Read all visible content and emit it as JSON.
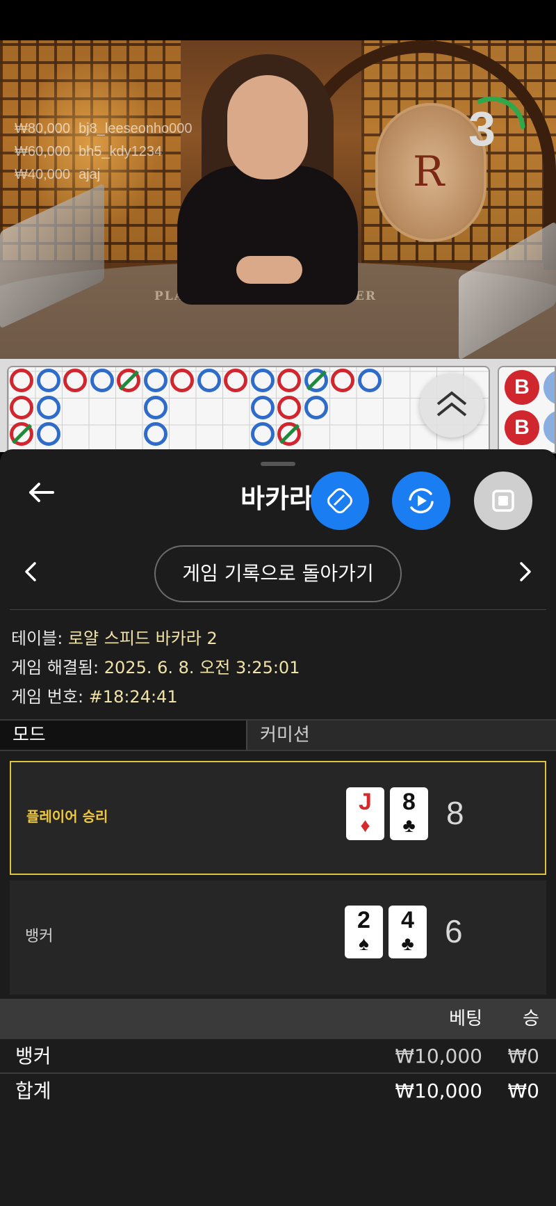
{
  "video": {
    "felt_labels": [
      "PLAYER",
      "BANKER"
    ],
    "emblem_letter": "R",
    "countdown": "3",
    "bets": [
      {
        "amount": "₩80,000",
        "user": "bj8_leeseonho000"
      },
      {
        "amount": "₩60,000",
        "user": "bh5_kdy1234"
      },
      {
        "amount": "₩40,000",
        "user": "ajaj"
      }
    ]
  },
  "roads": {
    "bead_labels": [
      "B",
      "B"
    ]
  },
  "sheet": {
    "title": "바카라",
    "back_to_history": "게임 기록으로 돌아가기",
    "info": {
      "table_label": "테이블:",
      "table_value": "로얄 스피드 바카라 2",
      "resolved_label": "게임 해결됨:",
      "resolved_value": "2025. 6. 8. 오전 3:25:01",
      "game_no_label": "게임 번호:",
      "game_no_value": "#18:24:41"
    },
    "tabs": {
      "mode": "모드",
      "commission": "커미션"
    },
    "results": {
      "player": {
        "label": "플레이어 승리",
        "cards": [
          {
            "rank": "J",
            "suit": "♦"
          },
          {
            "rank": "8",
            "suit": "♣"
          }
        ],
        "score": "8"
      },
      "banker": {
        "label": "뱅커",
        "cards": [
          {
            "rank": "2",
            "suit": "♠"
          },
          {
            "rank": "4",
            "suit": "♣"
          }
        ],
        "score": "6"
      }
    },
    "bet_table": {
      "headers": {
        "bet": "베팅",
        "win": "승"
      },
      "rows": [
        {
          "name": "뱅커",
          "bet": "₩10,000",
          "win": "₩0"
        },
        {
          "name": "합계",
          "bet": "₩10,000",
          "win": "₩0"
        }
      ]
    }
  },
  "colors": {
    "accent_blue": "#1a7df2",
    "win_border": "#e0c23a",
    "banker_red": "#d0262e",
    "player_blue": "#2f6cc9"
  }
}
